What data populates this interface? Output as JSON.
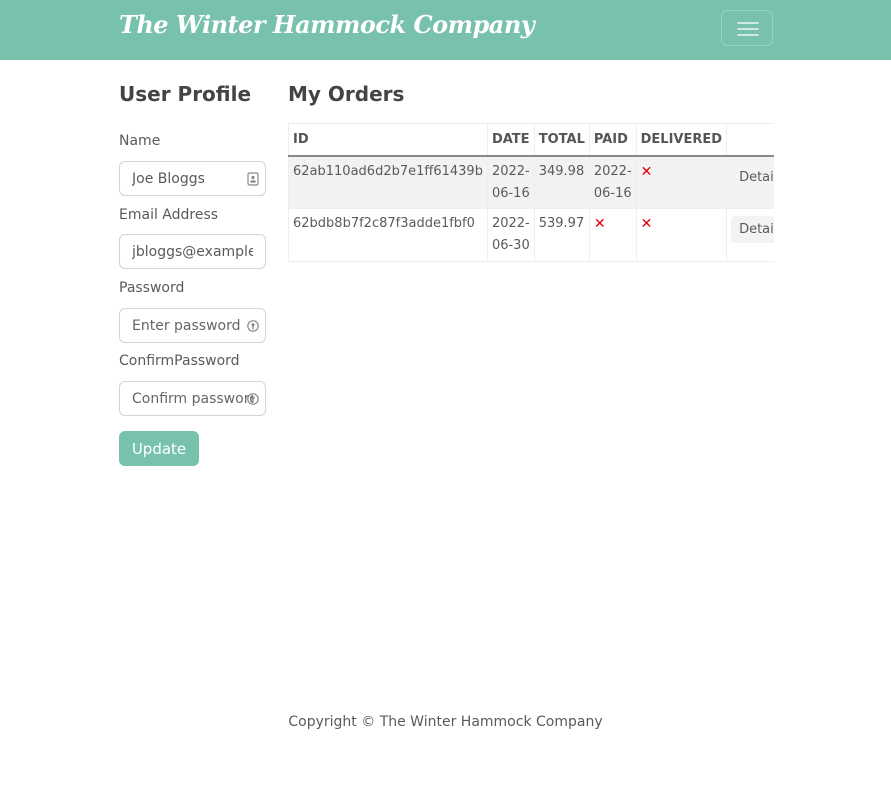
{
  "navbar": {
    "brand": "The Winter Hammock Company",
    "toggler_icon": "hamburger-menu-icon"
  },
  "profile": {
    "title": "User Profile",
    "name_label": "Name",
    "name_value": "Joe Bloggs",
    "name_icon": "contact-card-icon",
    "email_label": "Email Address",
    "email_value": "jbloggs@example",
    "password_label": "Password",
    "password_placeholder": "Enter password",
    "password_icon": "password-manager-icon",
    "confirm_label": "ConfirmPassword",
    "confirm_placeholder": "Confirm password",
    "confirm_icon": "password-manager-icon",
    "update_label": "Update",
    "accent_color": "#78c2ad"
  },
  "orders": {
    "title": "My Orders",
    "headers": [
      "ID",
      "DATE",
      "TOTAL",
      "PAID",
      "DELIVERED",
      ""
    ],
    "rows": [
      {
        "id": "62ab110ad6d2b7e1ff61439b",
        "date": "2022-06-16",
        "date_line1": "2022-",
        "date_line2": "06-16",
        "total": "349.98",
        "paid": "2022-06-16",
        "paid_line1": "2022-",
        "paid_line2": "06-16",
        "delivered": "✕",
        "action": "Details"
      },
      {
        "id": "62bdb8b7f2c87f3adde1fbf0",
        "date": "2022-06-30",
        "date_line1": "2022-",
        "date_line2": "06-30",
        "total": "539.97",
        "paid": "✕",
        "delivered": "✕",
        "action": "Details"
      }
    ],
    "cross_color": "#e0000a"
  },
  "footer": {
    "text": "Copyright © The Winter Hammock Company"
  }
}
